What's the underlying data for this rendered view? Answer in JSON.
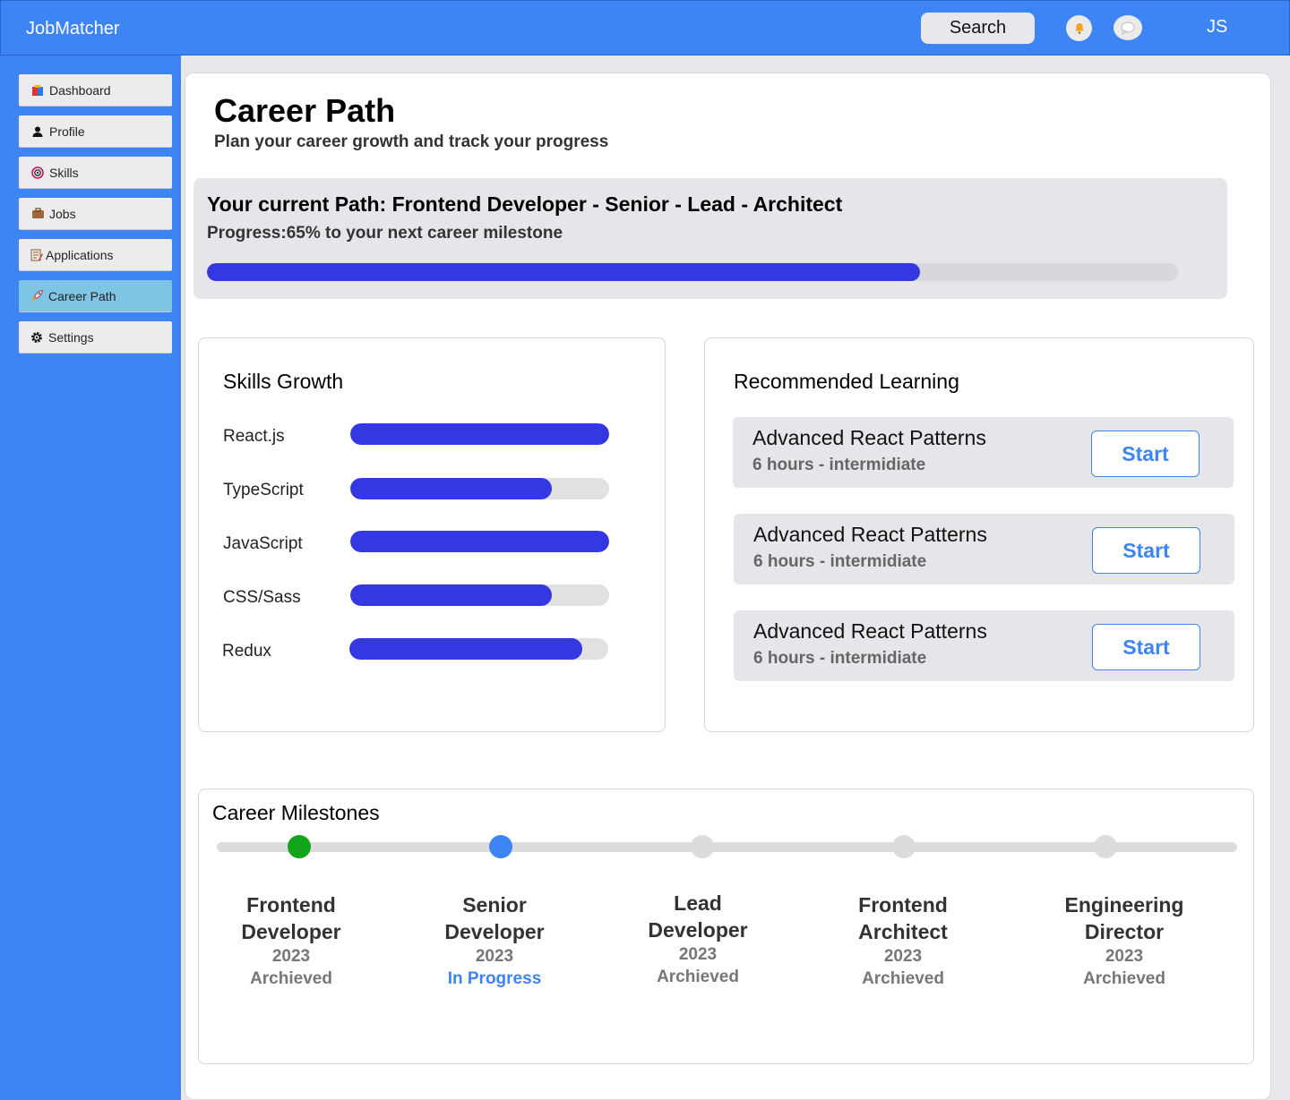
{
  "app": {
    "brand": "JobMatcher",
    "avatar_initials": "JS"
  },
  "topbar": {
    "search_label": "Search",
    "bell_icon": "bell-icon",
    "chat_icon": "chat-icon"
  },
  "sidebar": {
    "items": [
      {
        "label": "Dashboard",
        "icon": "dashboard-icon",
        "active": false
      },
      {
        "label": "Profile",
        "icon": "profile-icon",
        "active": false
      },
      {
        "label": "Skills",
        "icon": "target-icon",
        "active": false
      },
      {
        "label": "Jobs",
        "icon": "briefcase-icon",
        "active": false
      },
      {
        "label": "Applications",
        "icon": "memo-icon",
        "active": false
      },
      {
        "label": "Career Path",
        "icon": "rocket-icon",
        "active": true
      },
      {
        "label": "Settings",
        "icon": "gear-icon",
        "active": false
      }
    ]
  },
  "page": {
    "title": "Career Path",
    "subtitle": "Plan your career growth and track your progress"
  },
  "current_path": {
    "title": "Your current Path: Frontend Developer  - Senior - Lead - Architect",
    "progress_text": "Progress:65% to your next career milestone",
    "progress_fraction": 0.734
  },
  "skills": {
    "title": "Skills Growth",
    "items": [
      {
        "name": "React.js",
        "level": 1.0
      },
      {
        "name": "TypeScript",
        "level": 0.78
      },
      {
        "name": "JavaScript",
        "level": 1.0
      },
      {
        "name": "CSS/Sass",
        "level": 0.78
      },
      {
        "name": "Redux",
        "level": 0.9
      }
    ]
  },
  "learning": {
    "title": "Recommended Learning",
    "courses": [
      {
        "title": "Advanced React Patterns",
        "meta": "6 hours - intermidiate",
        "button": "Start"
      },
      {
        "title": "Advanced React Patterns",
        "meta": "6 hours - intermidiate",
        "button": "Start"
      },
      {
        "title": "Advanced React Patterns",
        "meta": "6 hours - intermidiate",
        "button": "Start"
      }
    ]
  },
  "milestones": {
    "title": "Career Milestones",
    "items": [
      {
        "line1": "Frontend",
        "line2": "Developer",
        "year": "2023",
        "status": "Archieved",
        "dot_color": "#12a51a"
      },
      {
        "line1": "Senior",
        "line2": "Developer",
        "year": "2023",
        "status": "In Progress",
        "dot_color": "#3d84f5",
        "status_color": "#3d84f5"
      },
      {
        "line1": "Lead",
        "line2": "Developer",
        "year": "2023",
        "status": "Archieved",
        "dot_color": "#dcdcdc"
      },
      {
        "line1": "Frontend",
        "line2": "Architect",
        "year": "2023",
        "status": "Archieved",
        "dot_color": "#dcdcdc"
      },
      {
        "line1": "Engineering",
        "line2": "Director",
        "year": "2023",
        "status": "Archieved",
        "dot_color": "#dcdcdc"
      }
    ]
  },
  "colors": {
    "brand_blue": "#3d84f5",
    "progress_fill": "#3538e0",
    "active_nav": "#7ec4e4"
  }
}
